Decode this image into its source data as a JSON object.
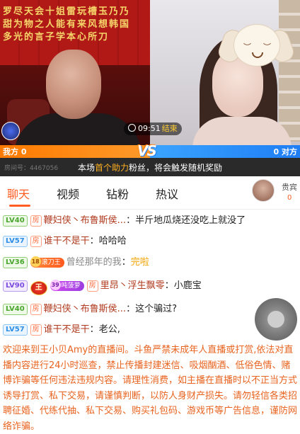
{
  "stream": {
    "timer": "09:51",
    "timer_end": "结束",
    "left_label": "我方 0",
    "right_label": "0 对方",
    "vs": "VS",
    "room_id": "房间号：4467056",
    "help_prefix": "本场",
    "help_highlight": "首个助力",
    "help_suffix": "粉丝，将会触发随机奖励",
    "left_banner_text": "罗尽天会十姐雷玩槽玉乃乃\n甜为物之人能有来风想韩国\n多光的言子学本心所刀",
    "colors": {
      "left_accent": "#ff7a00",
      "right_accent": "#1f7ef4"
    }
  },
  "tabs": [
    {
      "label": "聊天",
      "active": true
    },
    {
      "label": "视频",
      "active": false
    },
    {
      "label": "钻粉",
      "active": false
    },
    {
      "label": "热议",
      "active": false
    }
  ],
  "guest": {
    "label": "贵宾",
    "count": "0"
  },
  "chat": [
    {
      "level": "LV40",
      "level_color": "green",
      "room_tag": "房",
      "user": "鞭妇侠丶布鲁斯侯...",
      "sep": "：",
      "text": "半斤地瓜烧还没吃上就没了"
    },
    {
      "level": "LV57",
      "level_color": "blue",
      "room_tag": "房",
      "user": "谁干不是干",
      "sep": "：",
      "text": "哈哈哈"
    },
    {
      "level": "LV36",
      "level_color": "green",
      "fan_num": "18",
      "fan_name": "滚刀王",
      "user": "曾经那年的我",
      "sep": "：",
      "text": "完啦"
    },
    {
      "level": "LV90",
      "level_color": "purple",
      "king": "王",
      "fan_num": "39",
      "fan_name": "吨菠萝",
      "room_tag": "房",
      "user": "里昂丶浮生飘零",
      "sep": "：",
      "text": "小鹿宝"
    },
    {
      "level": "LV40",
      "level_color": "green",
      "room_tag": "房",
      "user": "鞭妇侠丶布鲁斯侯...",
      "sep": "：",
      "text": "这个骗过?"
    },
    {
      "level": "LV57",
      "level_color": "blue",
      "room_tag": "房",
      "user": "谁干不是干",
      "sep": "：",
      "text": "老公,"
    }
  ],
  "notice": "欢迎来到王小贝Amy的直播间。斗鱼严禁未成年人直播或打赏,依法对直播内容进行24小时巡查，禁止传播封建迷信、吸烟酗酒、低俗色情、赌博诈骗等任何违法违规内容。请理性消费，如主播在直播时以不正当方式诱导打赏、私下交易，请谨慎判断，以防人身财产损失。请勿轻信各类招聘征婚、代练代抽、私下交易、购买礼包码、游戏币等广告信息，谨防网络诈骗。"
}
